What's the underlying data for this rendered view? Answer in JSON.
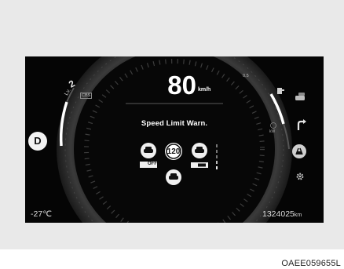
{
  "cluster": {
    "speed": "80",
    "speed_unit": "km/h",
    "warning_text": "Speed Limit Warn.",
    "speed_limit": "120",
    "gear": "D",
    "outside_temp": "-27",
    "temp_unit": "℃",
    "odometer": "1324025",
    "odometer_unit": "km",
    "drive_level_label": "Lv.",
    "drive_level": "2",
    "eco_marker": "CBS",
    "charge_label": "kW",
    "mode_badge": "OFF",
    "power_scale_label": "0.5"
  },
  "figure_code": "OAEE059655L",
  "colors": {
    "panel_bg": "#e9e9e9",
    "display_bg": "#050505",
    "gauge_ring": "#2a2a2a",
    "text": "#ffffff"
  }
}
